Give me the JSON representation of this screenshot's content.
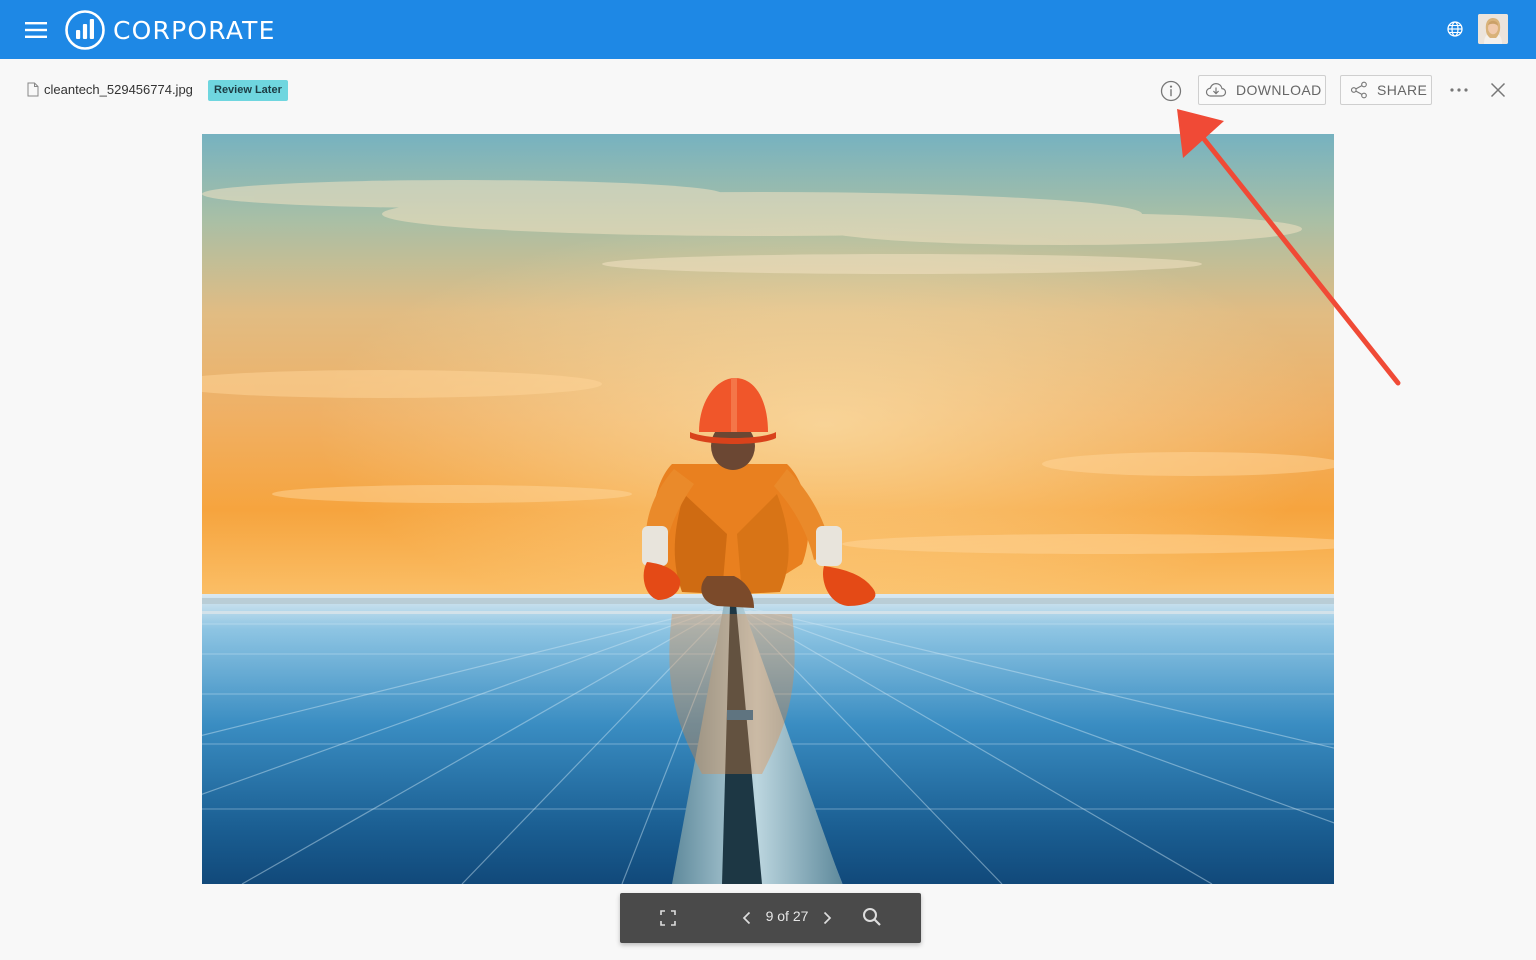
{
  "app": {
    "brand": "CORPORATE",
    "brand_color": "#1e88e5"
  },
  "header": {
    "menu_icon": "hamburger-menu-icon",
    "language_icon": "globe-icon",
    "user_avatar": "user-avatar"
  },
  "file_toolbar": {
    "file_name": "cleantech_529456774.jpg",
    "status_badge": "Review Later",
    "status_badge_color": "#6fd6df",
    "download_label": "DOWNLOAD",
    "share_label": "SHARE"
  },
  "viewer": {
    "counter": "9 of 27"
  },
  "annotation": {
    "arrow_color": "#f04a36"
  }
}
